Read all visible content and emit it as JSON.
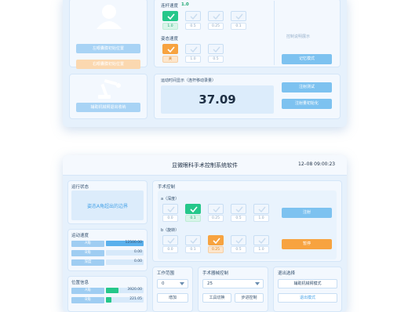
{
  "top": {
    "left_panel": {
      "btn_left_move": "左眼囊膜初始位置",
      "btn_right_move": "右眼囊膜初始位置",
      "btn_arm_exit": "辅助机械臂退出收纳"
    },
    "speed": {
      "label": "连杆速度",
      "current": "1.0",
      "options": [
        "1.0",
        "0.5",
        "0.25",
        "0.1"
      ]
    },
    "posture": {
      "label": "姿态速度",
      "options": [
        "关",
        "1.0",
        "0.5"
      ]
    },
    "right_panel": {
      "hint": "控制说明展示",
      "btn_memory": "记忆模式"
    },
    "time_panel": {
      "label": "运动时间显示（连杆移动录量）",
      "value": "37.09",
      "btn_test": "注射测试",
      "btn_init": "注射量初始化"
    }
  },
  "bottom": {
    "title": "显微眼科手术控制系统软件",
    "clock": "12–08 09:00:23",
    "status": {
      "label": "运行状态",
      "message": "姿态A角超出的边界"
    },
    "motion_speed": {
      "label": "运动速度",
      "rows": [
        {
          "name": "A角",
          "value": "12500.00",
          "fill": 1.0
        },
        {
          "name": "B角",
          "value": "0.00",
          "fill": 0
        },
        {
          "name": "深度",
          "value": "0.00",
          "fill": 0
        }
      ]
    },
    "position": {
      "label": "位置信息",
      "rows": [
        {
          "name": "A角",
          "value": "3920.00",
          "fill": 0.34
        },
        {
          "name": "B角",
          "value": "221.05",
          "fill": 0.15
        }
      ]
    },
    "surgery": {
      "label": "手术控制",
      "a_label": "a（深度）",
      "a_options": [
        "0.0",
        "0.1",
        "0.25",
        "0.5",
        "1.0"
      ],
      "b_label": "b（旋转）",
      "b_options": [
        "0.0",
        "0.1",
        "0.25",
        "0.5",
        "1.0"
      ],
      "btn_inject": "注射",
      "btn_pause": "暂停"
    },
    "work_range": {
      "label": "工作范围",
      "value": "0",
      "btn_add": "增加"
    },
    "handle": {
      "label": "手术器械控制",
      "value": "25",
      "btn_tool": "工具切换",
      "btn_step": "步进控制"
    },
    "exit": {
      "label": "退出选择",
      "btn_arm": "辅助机械臂模式",
      "btn_exit": "退出模式"
    }
  },
  "colors": {
    "accent": "#7dc2f0",
    "green": "#25c78a",
    "orange": "#f7a340"
  }
}
